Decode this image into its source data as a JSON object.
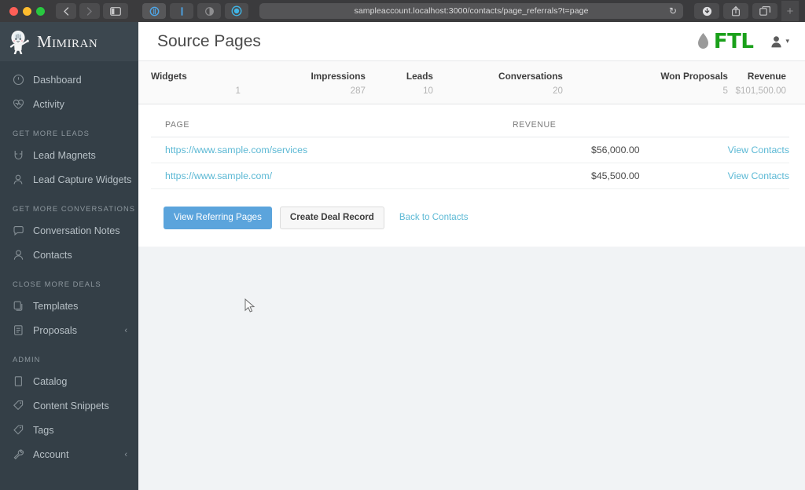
{
  "browser": {
    "url": "sampleaccount.localhost:3000/contacts/page_referrals?t=page",
    "back_icon": "chevron-left-icon",
    "forward_icon": "chevron-right-icon",
    "sidebar_toggle_icon": "sidebar-toggle-icon",
    "reload_icon": "reload-icon",
    "download_icon": "download-icon",
    "share_icon": "share-icon",
    "tabs_icon": "tab-overview-icon",
    "new_tab_label": "+",
    "tab_icons": [
      "tab-icon-1",
      "tab-icon-2",
      "tab-icon-3",
      "tab-icon-4"
    ]
  },
  "sidebar": {
    "brand": "Mimiran",
    "brand_icon": "mimiran-mascot-icon",
    "items": [
      {
        "label": "Dashboard",
        "icon": "speedometer-icon",
        "section": null,
        "caret": false
      },
      {
        "label": "Activity",
        "icon": "heart-pulse-icon",
        "section": null,
        "caret": false
      },
      {
        "label": "Lead Magnets",
        "icon": "magnet-icon",
        "section": "GET MORE LEADS",
        "caret": false
      },
      {
        "label": "Lead Capture Widgets",
        "icon": "user-plus-icon",
        "section": null,
        "caret": false
      },
      {
        "label": "Conversation Notes",
        "icon": "chat-bubble-icon",
        "section": "GET MORE CONVERSATIONS",
        "caret": false
      },
      {
        "label": "Contacts",
        "icon": "contacts-icon",
        "section": null,
        "caret": false
      },
      {
        "label": "Templates",
        "icon": "copy-icon",
        "section": "CLOSE MORE DEALS",
        "caret": false
      },
      {
        "label": "Proposals",
        "icon": "document-icon",
        "section": null,
        "caret": true
      },
      {
        "label": "Catalog",
        "icon": "book-icon",
        "section": "ADMIN",
        "caret": false
      },
      {
        "label": "Content Snippets",
        "icon": "tag-outline-icon",
        "section": null,
        "caret": false
      },
      {
        "label": "Tags",
        "icon": "tag-icon",
        "section": null,
        "caret": false
      },
      {
        "label": "Account",
        "icon": "wrench-icon",
        "section": null,
        "caret": true
      }
    ],
    "caret_glyph": "‹"
  },
  "header": {
    "title": "Source Pages",
    "logo_text": "FTL",
    "logo_icon": "flame-droplet-icon",
    "logo_color": "#1aa01a",
    "user_icon": "user-avatar-icon",
    "user_caret": "▾"
  },
  "stats": [
    {
      "label": "Widgets",
      "value": "1"
    },
    {
      "label": "Impressions",
      "value": "287"
    },
    {
      "label": "Leads",
      "value": "10"
    },
    {
      "label": "Conversations",
      "value": "20"
    },
    {
      "label": "Won Proposals",
      "value": "5"
    },
    {
      "label": "Revenue",
      "value": "$101,500.00"
    }
  ],
  "table": {
    "columns": {
      "page": "PAGE",
      "revenue": "REVENUE",
      "actions": ""
    },
    "rows": [
      {
        "page": "https://www.sample.com/services",
        "revenue": "$56,000.00",
        "action": "View Contacts"
      },
      {
        "page": "https://www.sample.com/",
        "revenue": "$45,500.00",
        "action": "View Contacts"
      }
    ]
  },
  "actions": {
    "primary": "View Referring Pages",
    "secondary": "Create Deal Record",
    "link": "Back to Contacts"
  },
  "colors": {
    "sidebar_bg": "#343f47",
    "primary_button": "#5ba4dc",
    "link": "#5cb9d5",
    "brand_green": "#1aa01a"
  }
}
